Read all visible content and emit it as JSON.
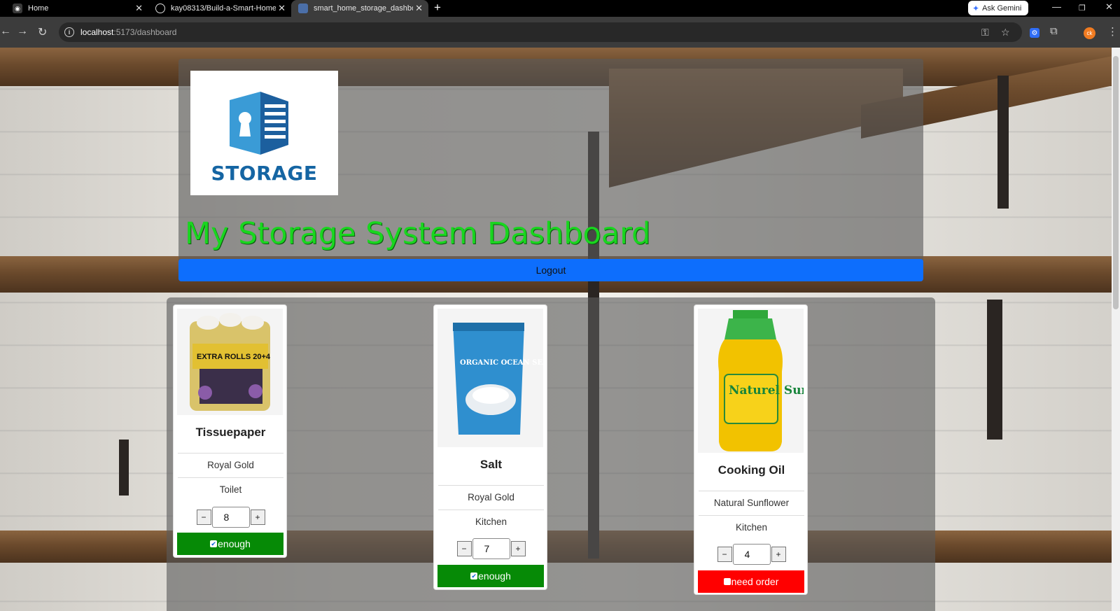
{
  "browser": {
    "tabs": [
      {
        "title": "Home",
        "active": false
      },
      {
        "title": "kay08313/Build-a-Smart-Home",
        "active": false
      },
      {
        "title": "smart_home_storage_dashboard",
        "active": true
      }
    ],
    "ask_gemini": "Ask Gemini",
    "url_host": "localhost",
    "url_path": ":5173/dashboard",
    "profile_initials": "ck"
  },
  "header": {
    "logo_text": "STORAGE",
    "title": "My Storage System Dashboard",
    "logout_label": "Logout"
  },
  "products": [
    {
      "name": "Tissuepaper",
      "brand": "Royal Gold",
      "location": "Toilet",
      "quantity": "8",
      "status": "enough",
      "status_ok": true
    },
    {
      "name": "Salt",
      "brand": "Royal Gold",
      "location": "Kitchen",
      "quantity": "7",
      "status": "enough",
      "status_ok": true
    },
    {
      "name": "Cooking Oil",
      "brand": "Natural Sunflower",
      "location": "Kitchen",
      "quantity": "4",
      "status": "need order",
      "status_ok": false
    }
  ],
  "product_images": {
    "tissue_pack_text": "EXTRA ROLLS 20+4",
    "salt_pack_text": "ORGANIC OCEAN SEA SALT",
    "oil_pack_text": "Naturel Sunflower"
  },
  "colors": {
    "title_green": "#19d61f",
    "logout_blue": "#0d6efd",
    "status_ok": "#068a06",
    "status_bad": "#ff0000",
    "logo_blue": "#1565a3"
  },
  "icons": [
    "github-icon",
    "info-icon",
    "key-icon",
    "star-icon",
    "extensions-icon",
    "menu-icon",
    "reload-icon",
    "back-icon",
    "forward-icon"
  ]
}
